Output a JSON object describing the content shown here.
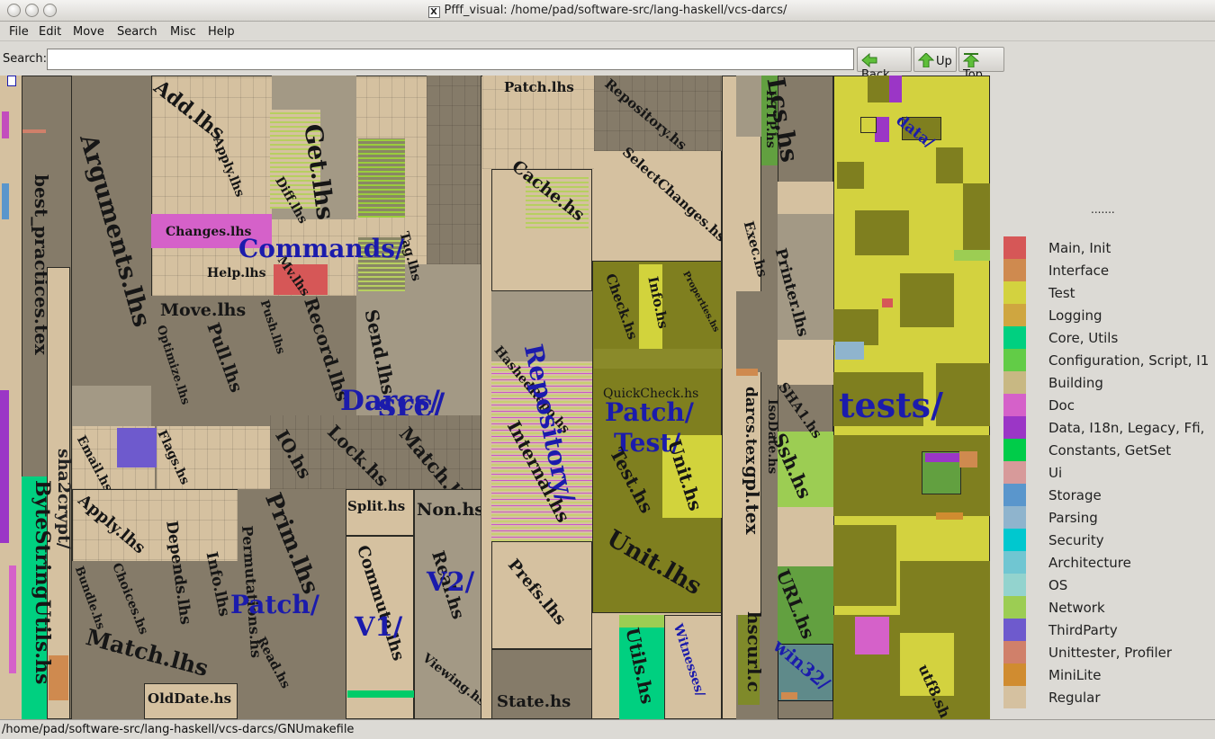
{
  "window": {
    "title": "Pfff_visual: /home/pad/software-src/lang-haskell/vcs-darcs/",
    "x_glyph": "X"
  },
  "menu": [
    "File",
    "Edit",
    "Move",
    "Search",
    "Misc",
    "Help"
  ],
  "search": {
    "label": "Search:",
    "value": ""
  },
  "nav": {
    "back": "Back",
    "up": "Up",
    "top": "Top"
  },
  "files": {
    "best_practices": "best_practices.tex",
    "bytestring": "ByteStringUtils.hs",
    "shcrypt": "sha2crypt/",
    "arguments": "Arguments.lhs",
    "add": "Add.lhs",
    "apply_cmd": "Apply.lhs",
    "diff": "Diff.lhs",
    "get": "Get.lhs",
    "tag": "Tag.lhs",
    "changes": "Changes.lhs",
    "help": "Help.lhs",
    "commands_dir": "Commands/",
    "mv": "Mv.lhs",
    "record": "Record.lhs",
    "send": "Send.lhs",
    "move": "Move.lhs",
    "optimize": "Optimize.lhs",
    "pull": "Pull.lhs",
    "push": "Push.lhs",
    "darcs": "Darcs/",
    "src": "src/",
    "email": "Email.hs",
    "flags": "Flags.hs",
    "io": "IO.hs",
    "lock": "Lock.hs",
    "match": "Match.lhs",
    "apply_patch": "Apply.lhs",
    "depends": "Depends.lhs",
    "info": "Info.lhs",
    "permutations": "Permutations.hs",
    "prim": "Prim.lhs",
    "bundle": "Bundle.hs",
    "choices": "Choices.hs",
    "patch_dir": "Patch/",
    "read": "Read.hs",
    "match2": "Match.lhs",
    "olddate": "OldDate.hs",
    "split": "Split.hs",
    "commute": "Commute.lhs",
    "v1": "V1/",
    "non": "Non.hs",
    "real": "Real.hs",
    "v2": "V2/",
    "viewing": "Viewing.hs",
    "patch_lhs": "Patch.lhs",
    "cache": "Cache.hs",
    "repo_dir": "Repository/",
    "hashed": "HashedRepo.hs",
    "internal": "Internal.hs",
    "prefs": "Prefs.lhs",
    "state": "State.hs",
    "repository_hs": "Repository.hs",
    "selectchanges": "SelectChanges.hs",
    "check": "Check.hs",
    "infohs": "Info.hs",
    "properties": "Properties.hs",
    "quickcheck": "QuickCheck.hs",
    "patch_test": "Patch/",
    "test_dir": "Test/",
    "tesths": "Test.hs",
    "unithsa": "Unit.hs",
    "unitlhs": "Unit.lhs",
    "utils": "Utils.hs",
    "witnesses": "Witnesses/",
    "exec": "Exec.hs",
    "darcstex": "darcs.tex",
    "http": "HTTP.hs",
    "isodate": "IsoDate.hs",
    "lcs": "Lcs.hs",
    "printer": "Printer.lhs",
    "sha1": "SHA1.hs",
    "ssh": "Ssh.hs",
    "gpl": "gpl.tex",
    "url": "URL.hs",
    "hscurl": "hscurl.c",
    "win32": "win32/",
    "tests": "tests/",
    "data": "data/",
    "utf8": "utf8.sh"
  },
  "legend": {
    "dots": ".......",
    "items": [
      {
        "label": "Main, Init",
        "color": "#d65757"
      },
      {
        "label": "Interface",
        "color": "#cf8a4f"
      },
      {
        "label": "Test",
        "color": "#d3d23f"
      },
      {
        "label": "Logging",
        "color": "#cfa640"
      },
      {
        "label": "Core, Utils",
        "color": "#00d080"
      },
      {
        "label": "Configuration, Script, I1",
        "color": "#62cc47"
      },
      {
        "label": "Building",
        "color": "#c8b883"
      },
      {
        "label": "Doc",
        "color": "#d561c9"
      },
      {
        "label": "Data, I18n, Legacy, Ffi,",
        "color": "#9b36c6"
      },
      {
        "label": "Constants, GetSet",
        "color": "#00cc49"
      },
      {
        "label": "Ui",
        "color": "#d79a9a"
      },
      {
        "label": "Storage",
        "color": "#5a96cc"
      },
      {
        "label": "Parsing",
        "color": "#8fb4cd"
      },
      {
        "label": "Security",
        "color": "#00c8cf"
      },
      {
        "label": "Architecture",
        "color": "#70c6d2"
      },
      {
        "label": "OS",
        "color": "#93d3ce"
      },
      {
        "label": "Network",
        "color": "#9ccd53"
      },
      {
        "label": "ThirdParty",
        "color": "#6e5acd"
      },
      {
        "label": "Unittester, Profiler",
        "color": "#d0806a"
      },
      {
        "label": "MiniLite",
        "color": "#d08c30"
      },
      {
        "label": "Regular",
        "color": "#d5c1a0"
      }
    ]
  },
  "status": {
    "path": "/home/pad/software-src/lang-haskell/vcs-darcs/GNUmakefile"
  }
}
